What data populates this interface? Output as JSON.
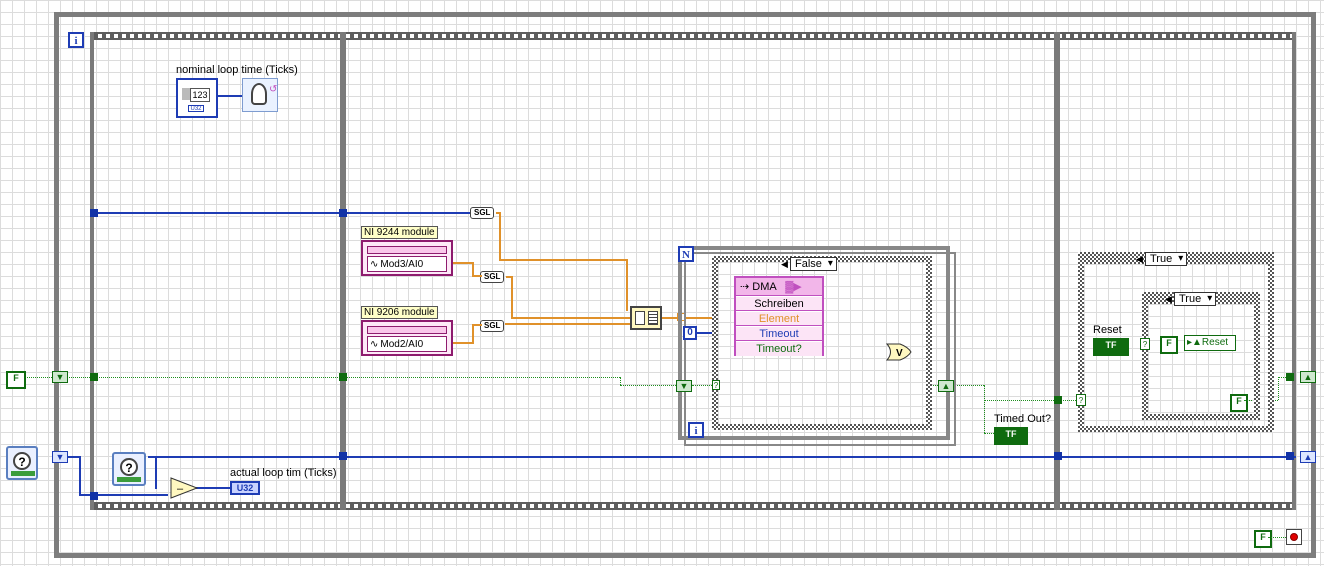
{
  "constants": {
    "false_label": "F",
    "zero_label": "0",
    "true_false_label": "TF",
    "question_mark": "?"
  },
  "labels": {
    "nominal_loop_time": "nominal loop time (Ticks)",
    "actual_loop_time": "actual loop tim (Ticks)",
    "timed_out": "Timed Out?",
    "reset": "Reset",
    "reset_property": "Reset",
    "ni9244": "NI 9244 module",
    "ni9206": "NI 9206 module"
  },
  "io": {
    "mod3": "Mod3/AI0",
    "mod2": "Mod2/AI0"
  },
  "conversions": {
    "sgl": "SGL"
  },
  "data_types": {
    "u32": "U32",
    "numeric_123": "123"
  },
  "dma": {
    "title": "DMA",
    "mode": "Schreiben",
    "element": "Element",
    "timeout": "Timeout",
    "timed_out": "Timeout?"
  },
  "structures": {
    "iteration_label": "i",
    "count_label": "N",
    "case_false": "False",
    "case_true_outer": "True",
    "case_true_inner": "True",
    "or_label": "V"
  },
  "colors": {
    "wire_blue": "#1e3cb4",
    "wire_orange": "#e0912a",
    "wire_boolean": "#1f8f1f",
    "dma_pink": "#c04fbf",
    "io_purple": "#8e1b6e",
    "stop_red": "#e00000"
  }
}
